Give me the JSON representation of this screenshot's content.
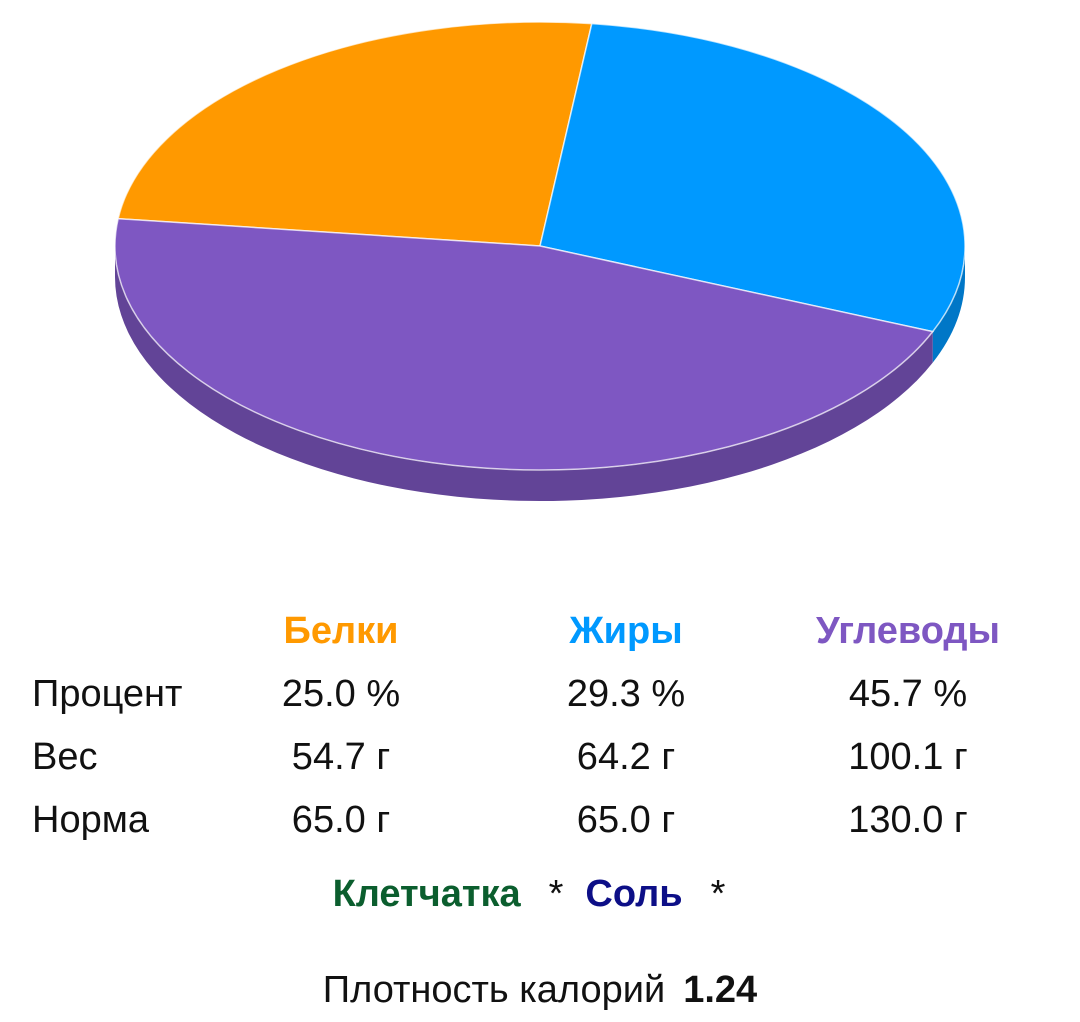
{
  "chart_data": {
    "type": "pie",
    "style": "3d",
    "slices": [
      {
        "label": "Белки",
        "value": 25.0,
        "color": "#FF9900"
      },
      {
        "label": "Жиры",
        "value": 29.3,
        "color": "#0099FF"
      },
      {
        "label": "Углеводы",
        "value": 45.7,
        "color": "#7E57C2"
      }
    ]
  },
  "table": {
    "headers": [
      {
        "label": "Белки",
        "color": "#FF9900"
      },
      {
        "label": "Жиры",
        "color": "#0099FF"
      },
      {
        "label": "Углеводы",
        "color": "#7E57C2"
      }
    ],
    "rows": [
      {
        "label": "Процент",
        "values": [
          "25.0 %",
          "29.3 %",
          "45.7 %"
        ]
      },
      {
        "label": "Вес",
        "values": [
          "54.7 г",
          "64.2 г",
          "100.1 г"
        ]
      },
      {
        "label": "Норма",
        "values": [
          "65.0 г",
          "65.0 г",
          "130.0 г"
        ]
      }
    ]
  },
  "extras": {
    "fiber": {
      "label": "Клетчатка",
      "color": "#0B5E2E"
    },
    "fiber_mark": "*",
    "salt": {
      "label": "Соль",
      "color": "#0D0F87"
    },
    "salt_mark": "*"
  },
  "density": {
    "label": "Плотность калорий",
    "value": "1.24"
  }
}
